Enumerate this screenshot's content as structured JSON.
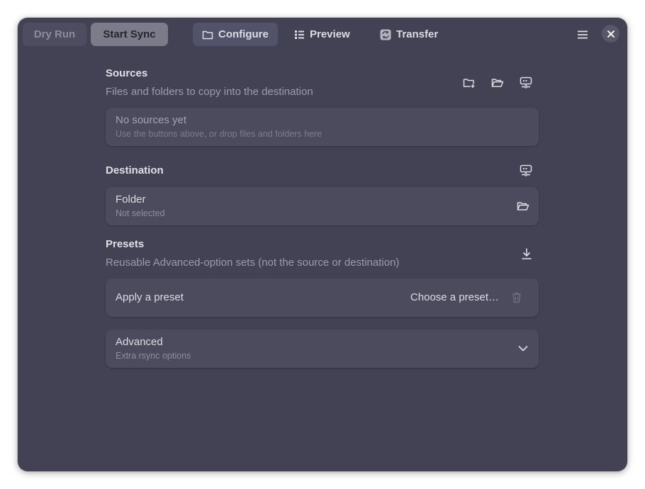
{
  "header": {
    "dry_run_label": "Dry Run",
    "start_sync_label": "Start Sync",
    "tabs": [
      {
        "label": "Configure",
        "icon": "folder-icon"
      },
      {
        "label": "Preview",
        "icon": "list-icon"
      },
      {
        "label": "Transfer",
        "icon": "sync-icon"
      }
    ],
    "menu_icon": "hamburger-menu-icon",
    "close_icon": "close-icon"
  },
  "sources": {
    "title": "Sources",
    "subtitle": "Files and folders to copy into the destination",
    "empty_title": "No sources yet",
    "empty_hint": "Use the buttons above, or drop files and folders here"
  },
  "destination": {
    "title": "Destination",
    "row_title": "Folder",
    "row_value": "Not selected"
  },
  "presets": {
    "title": "Presets",
    "subtitle": "Reusable Advanced-option sets (not the source or destination)",
    "row_title": "Apply a preset",
    "choose_label": "Choose a preset…"
  },
  "advanced": {
    "title": "Advanced",
    "subtitle": "Extra rsync options"
  },
  "colors": {
    "window_bg": "#424254",
    "card_bg": "#4b4b5d",
    "active_tab_bg": "#52526a",
    "start_button_bg": "#7b7b8a"
  }
}
